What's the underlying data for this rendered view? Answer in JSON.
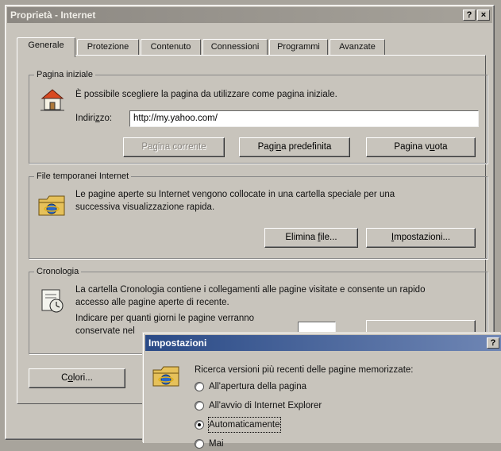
{
  "window": {
    "title": "Proprietà - Internet",
    "help_button": "?",
    "close_button": "×"
  },
  "tabs": [
    {
      "label": "Generale"
    },
    {
      "label": "Protezione"
    },
    {
      "label": "Contenuto"
    },
    {
      "label": "Connessioni"
    },
    {
      "label": "Programmi"
    },
    {
      "label": "Avanzate"
    }
  ],
  "home_page": {
    "title": "Pagina iniziale",
    "description": "È possibile scegliere la pagina da utilizzare come pagina iniziale.",
    "address_label": "Indirizzo:",
    "address_value": "http://my.yahoo.com/",
    "btn_current": "Pagina corrente",
    "btn_default": "Pagina predefinita",
    "btn_blank": "Pagina vuota"
  },
  "temp_files": {
    "title": "File temporanei Internet",
    "description_line1": "Le pagine aperte su Internet vengono collocate in una cartella speciale per una",
    "description_line2": "successiva visualizzazione rapida.",
    "btn_delete": "Elimina file...",
    "btn_settings": "Impostazioni..."
  },
  "history": {
    "title": "Cronologia",
    "description_line1": "La cartella Cronologia contiene i collegamenti alle pagine visitate e consente un rapido",
    "description_line2": "accesso alle pagine aperte di recente.",
    "days_line1": "Indicare per quanti giorni le pagine verranno",
    "days_line2": "conservate nel"
  },
  "footer": {
    "btn_colors": "Colori..."
  },
  "settings_dialog": {
    "title": "Impostazioni",
    "help_button": "?",
    "prompt": "Ricerca versioni più recenti delle pagine memorizzate:",
    "options": [
      {
        "label": "All'apertura della pagina",
        "checked": false
      },
      {
        "label": "All'avvio di Internet Explorer",
        "checked": false
      },
      {
        "label": "Automaticamente",
        "checked": true
      },
      {
        "label": "Mai",
        "checked": false
      }
    ]
  }
}
